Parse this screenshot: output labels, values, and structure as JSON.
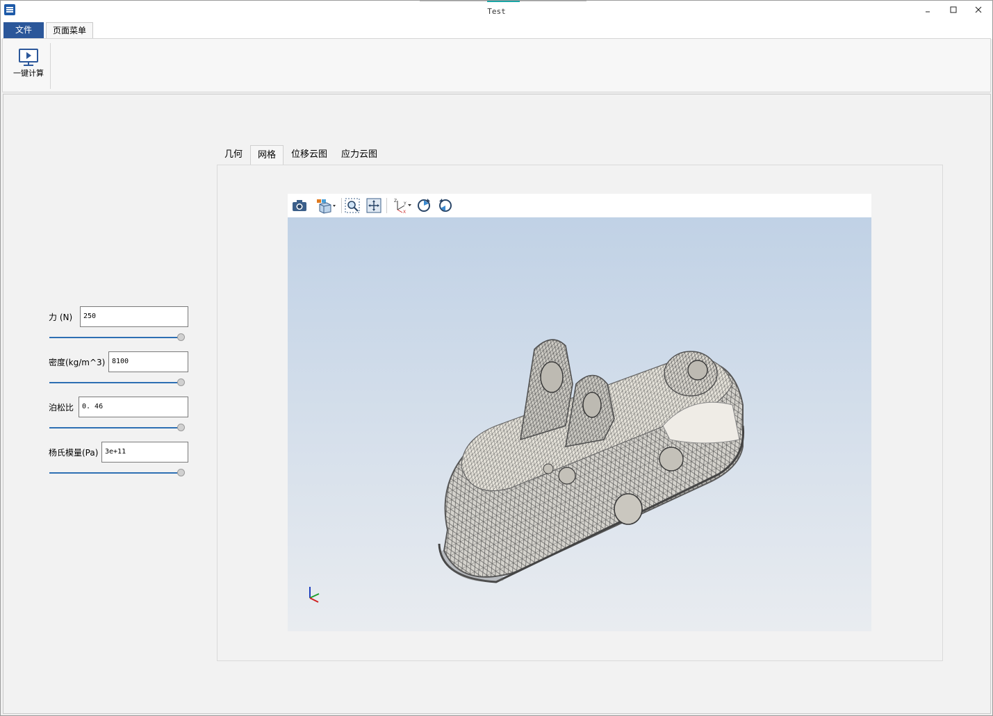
{
  "window": {
    "title": "Test"
  },
  "ribbon": {
    "tabs": [
      {
        "label": "文件"
      },
      {
        "label": "页面菜单"
      }
    ],
    "buttons": [
      {
        "label": "一键计算",
        "icon": "run-monitor-icon"
      }
    ]
  },
  "params": [
    {
      "label": "力 (N)",
      "value": "250",
      "slider_level": 1.0
    },
    {
      "label": "密度(kg/m^3)",
      "value": "8100",
      "slider_level": 1.0
    },
    {
      "label": "泊松比",
      "value": "0. 46",
      "slider_level": 1.0
    },
    {
      "label": "杨氏模量(Pa)",
      "value": "3e+11",
      "slider_level": 1.0
    }
  ],
  "view_tabs": [
    {
      "label": "几何"
    },
    {
      "label": "网格",
      "active": true
    },
    {
      "label": "位移云图"
    },
    {
      "label": "应力云图"
    }
  ],
  "viewer": {
    "toolbar": [
      {
        "icon": "camera-icon"
      },
      {
        "icon": "display-mode-icon"
      },
      {
        "icon": "zoom-window-icon"
      },
      {
        "icon": "fit-all-icon"
      },
      {
        "icon": "axes-orientation-icon"
      },
      {
        "icon": "rotate-cw-icon"
      },
      {
        "icon": "rotate-ccw-icon"
      }
    ]
  }
}
